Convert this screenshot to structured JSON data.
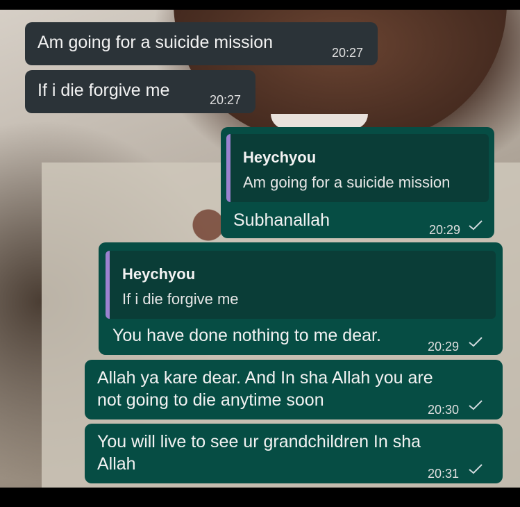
{
  "messages": [
    {
      "type": "incoming",
      "text": "Am going for a suicide mission",
      "time": "20:27"
    },
    {
      "type": "incoming",
      "text": "If i die forgive me",
      "time": "20:27"
    },
    {
      "type": "outgoing",
      "quote": {
        "author": "Heychyou",
        "text": "Am going for a suicide mission"
      },
      "text": "Subhanallah",
      "time": "20:29",
      "status": "check-icon"
    },
    {
      "type": "outgoing",
      "quote": {
        "author": "Heychyou",
        "text": "If i die forgive me"
      },
      "text": "You have done nothing to me dear.",
      "time": "20:29",
      "status": "check-icon"
    },
    {
      "type": "outgoing",
      "text_lines": [
        "Allah ya kare dear. And In sha Allah you are",
        "not going to die anytime soon"
      ],
      "time": "20:30",
      "status": "check-icon"
    },
    {
      "type": "outgoing",
      "text_lines": [
        "You will live to see ur grandchildren In sha",
        "Allah"
      ],
      "time": "20:31",
      "status": "check-icon"
    }
  ],
  "colors": {
    "incoming_bubble": "#2b3338",
    "outgoing_bubble": "#064d44",
    "quote_bar": "#9b82d0"
  }
}
